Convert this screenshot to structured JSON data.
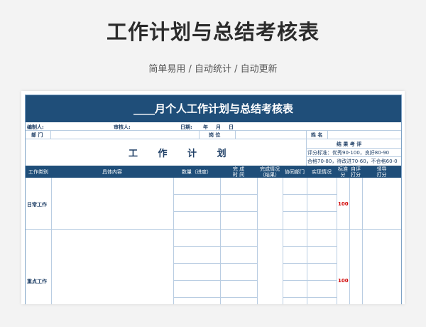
{
  "hero": {
    "title": "工作计划与总结考核表",
    "subtitle": "简单易用 / 自动统计 / 自动更新"
  },
  "sheet": {
    "banner": "____月个人工作计划与总结考核表",
    "meta": {
      "editor": "编制人:",
      "reviewer": "审核人:",
      "date": "日期:",
      "year": "年",
      "month": "月",
      "day": "日"
    },
    "labels": {
      "dept": "部 门",
      "position": "岗 位",
      "name": "姓 名"
    },
    "section_title": "工 作 计 划",
    "assessment": {
      "title": "结 果 考 评",
      "standard_1": "评分标准：优秀90-100，良好80-90",
      "standard_2": "合格70-80，待改进70-60，不合格60-0"
    },
    "columns": {
      "category": "工作类别",
      "content": "具体内容",
      "quantity": "数量（进度）",
      "complete_time": "完 成\n时 间",
      "complete_status": "完成情况\n（结果）",
      "dept_coop": "协同部门",
      "actual": "实现情况",
      "standard": "标准\n分",
      "self_score": "自评\n打分",
      "leader_score": "领导\n打分"
    },
    "rows": [
      {
        "category": "日常工作",
        "standard": "100"
      },
      {
        "category": "重点工作",
        "standard": "100"
      }
    ]
  }
}
